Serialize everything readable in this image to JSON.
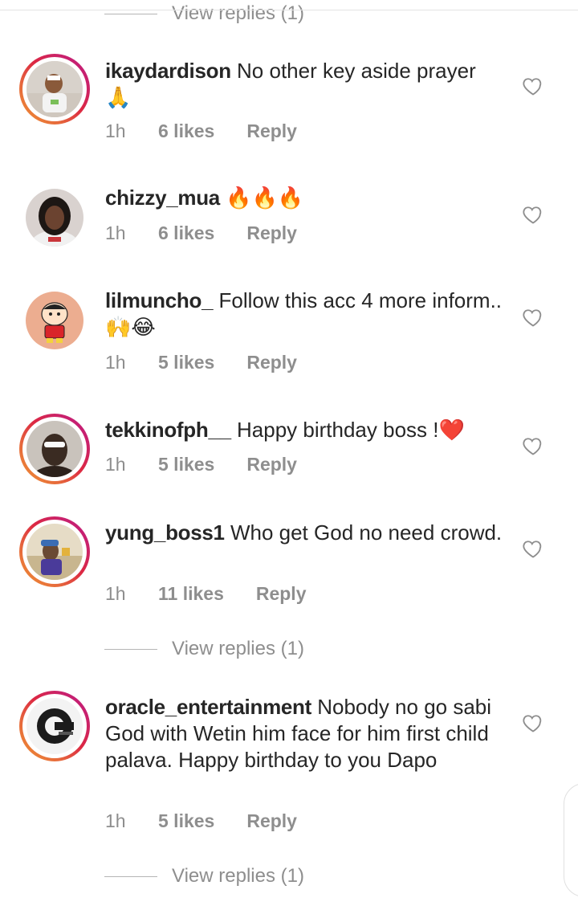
{
  "replies_label": "View replies (1)",
  "comments": [
    {
      "username": "ikaydardison",
      "text": "No other key aside prayer 🙏",
      "time": "1h",
      "likes": "6 likes",
      "reply": "Reply"
    },
    {
      "username": "chizzy_mua",
      "text": "🔥🔥🔥",
      "time": "1h",
      "likes": "6 likes",
      "reply": "Reply"
    },
    {
      "username": "lilmuncho_",
      "text": "Follow this acc 4 more inform..🙌😂",
      "time": "1h",
      "likes": "5 likes",
      "reply": "Reply"
    },
    {
      "username": "tekkinofph__",
      "text": "Happy birthday boss !❤️",
      "time": "1h",
      "likes": "5 likes",
      "reply": "Reply"
    },
    {
      "username": "yung_boss1",
      "text": "Who get God no need crowd.",
      "time": "1h",
      "likes": "11 likes",
      "reply": "Reply"
    },
    {
      "username": "oracle_entertainment",
      "text": "Nobody no go sabi God with Wetin him face for him first child palava. Happy birthday to you Dapo",
      "time": "1h",
      "likes": "5 likes",
      "reply": "Reply"
    }
  ],
  "icons": {
    "like": "heart-outline-icon"
  },
  "colors": {
    "story_ring_start": "#f09433",
    "story_ring_end": "#bc1888",
    "meta_text": "#8e8e8e",
    "primary_text": "#262626"
  }
}
